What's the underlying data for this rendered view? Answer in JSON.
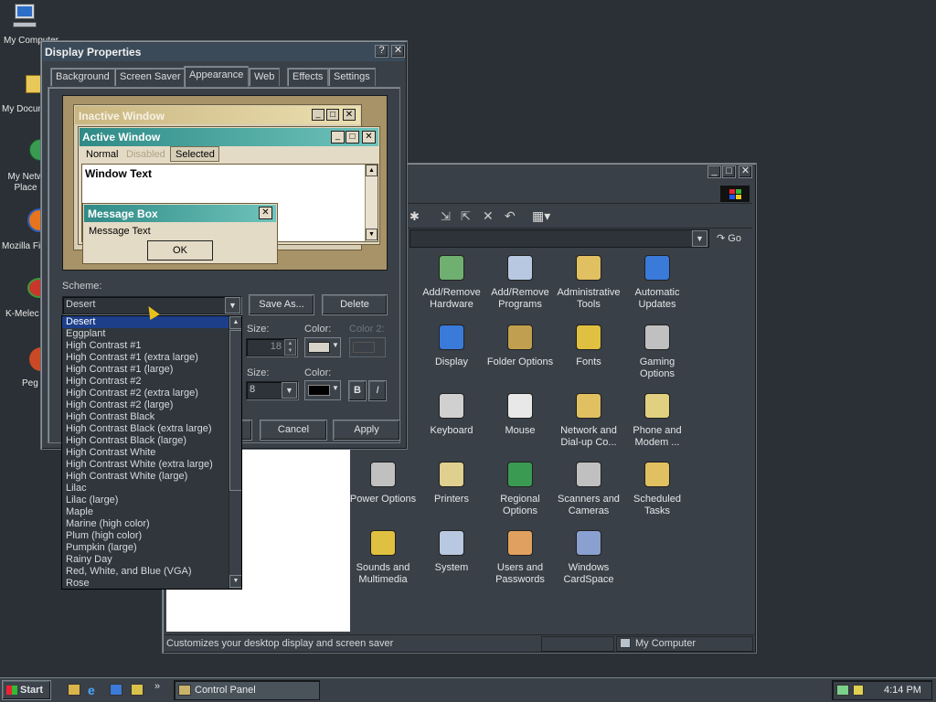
{
  "desktop": {
    "icons": [
      {
        "label": "My Computer"
      },
      {
        "label": "My Docum"
      },
      {
        "label": "My Netw Place"
      },
      {
        "label": "Mozilla Fi"
      },
      {
        "label": "K-Melec"
      },
      {
        "label": "Peg"
      }
    ]
  },
  "control_panel": {
    "address_dropdown": "▼",
    "go_label": "Go",
    "items": [
      {
        "label": "Add/Remove Hardware",
        "icon": "hardware-icon"
      },
      {
        "label": "Add/Remove Programs",
        "icon": "programs-icon"
      },
      {
        "label": "Administrative Tools",
        "icon": "admin-tools-icon"
      },
      {
        "label": "Automatic Updates",
        "icon": "updates-icon"
      },
      {
        "label": "Display",
        "icon": "display-icon"
      },
      {
        "label": "Folder Options",
        "icon": "folder-options-icon"
      },
      {
        "label": "Fonts",
        "icon": "fonts-icon"
      },
      {
        "label": "Gaming Options",
        "icon": "gaming-icon"
      },
      {
        "label": "Keyboard",
        "icon": "keyboard-icon"
      },
      {
        "label": "Mouse",
        "icon": "mouse-icon"
      },
      {
        "label": "Network and Dial-up Co...",
        "icon": "network-icon"
      },
      {
        "label": "Phone and Modem ...",
        "icon": "phone-icon"
      },
      {
        "label": "Power Options",
        "icon": "power-icon"
      },
      {
        "label": "Printers",
        "icon": "printers-icon"
      },
      {
        "label": "Regional Options",
        "icon": "globe-icon"
      },
      {
        "label": "Scanners and Cameras",
        "icon": "scanner-icon"
      },
      {
        "label": "Scheduled Tasks",
        "icon": "tasks-icon"
      },
      {
        "label": "Sounds and Multimedia",
        "icon": "sound-icon"
      },
      {
        "label": "System",
        "icon": "system-icon"
      },
      {
        "label": "Users and Passwords",
        "icon": "users-icon"
      },
      {
        "label": "Windows CardSpace",
        "icon": "cardspace-icon"
      }
    ],
    "status_text": "Customizes your desktop display and screen saver",
    "status_zone": "My Computer"
  },
  "dialog": {
    "title": "Display Properties",
    "help_btn": "?",
    "close_btn": "✕",
    "tabs": [
      "Background",
      "Screen Saver",
      "Appearance",
      "Web",
      "Effects",
      "Settings"
    ],
    "active_tab": "Appearance",
    "preview": {
      "inactive_title": "Inactive Window",
      "active_title": "Active Window",
      "menu_normal": "Normal",
      "menu_disabled": "Disabled",
      "menu_selected": "Selected",
      "window_text": "Window Text",
      "msgbox_title": "Message Box",
      "msgbox_text": "Message Text",
      "ok": "OK"
    },
    "scheme_label": "Scheme:",
    "scheme_value": "Desert",
    "save_as": "Save As...",
    "delete": "Delete",
    "size_label": "Size:",
    "color_label": "Color:",
    "color2_label": "Color 2:",
    "size_value": "18",
    "font_size_label": "Size:",
    "font_color_label": "Color:",
    "font_size_value": "8",
    "bold": "B",
    "italic": "I",
    "cancel": "Cancel",
    "apply": "Apply",
    "scheme_options": [
      "Desert",
      "Eggplant",
      "High Contrast #1",
      "High Contrast #1 (extra large)",
      "High Contrast #1 (large)",
      "High Contrast #2",
      "High Contrast #2 (extra large)",
      "High Contrast #2 (large)",
      "High Contrast Black",
      "High Contrast Black (extra large)",
      "High Contrast Black (large)",
      "High Contrast White",
      "High Contrast White (extra large)",
      "High Contrast White (large)",
      "Lilac",
      "Lilac (large)",
      "Maple",
      "Marine (high color)",
      "Plum (high color)",
      "Pumpkin (large)",
      "Rainy Day",
      "Red, White, and Blue (VGA)",
      "Rose"
    ]
  },
  "taskbar": {
    "start": "Start",
    "task": "Control Panel",
    "clock": "4:14 PM"
  },
  "colors": {
    "desert_title": "#d6c58a",
    "desert_active": "#2f8a86",
    "desert_bg": "#a89268",
    "selection": "#1d3f8a"
  }
}
